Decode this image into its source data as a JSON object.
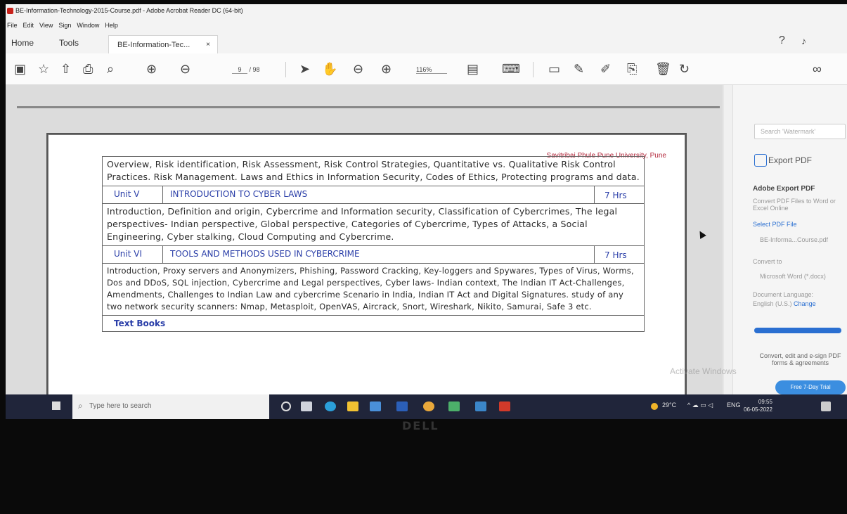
{
  "window": {
    "title": "BE-Information-Technology-2015-Course.pdf - Adobe Acrobat Reader DC (64-bit)",
    "menu": [
      "File",
      "Edit",
      "View",
      "Sign",
      "Window",
      "Help"
    ]
  },
  "tabs": {
    "home": "Home",
    "tools": "Tools",
    "document": "BE-Information-Tec...",
    "close": "×"
  },
  "toolbar": {
    "page_current": "9",
    "page_total": "/ 98",
    "zoom": "116%"
  },
  "page": {
    "university": "Savitribai Phule Pune University, Pune",
    "intro_text": "Overview, Risk identification, Risk Assessment, Risk Control Strategies, Quantitative vs. Qualitative Risk Control Practices. Risk Management. Laws and Ethics in Information Security, Codes of Ethics, Protecting programs and data.",
    "units": [
      {
        "unit": "Unit V",
        "title": "INTRODUCTION TO CYBER LAWS",
        "hours": "7 Hrs",
        "content": "Introduction, Definition and origin, Cybercrime and Information security, Classification of Cybercrimes, The legal perspectives- Indian perspective, Global perspective, Categories of Cybercrime, Types of Attacks, a Social Engineering, Cyber stalking, Cloud Computing and Cybercrime."
      },
      {
        "unit": "Unit VI",
        "title": "TOOLS AND METHODS USED IN CYBERCRIME",
        "hours": "7 Hrs",
        "content": "Introduction, Proxy servers and Anonymizers, Phishing, Password Cracking, Key-loggers and Spywares, Types of Virus, Worms, Dos and DDoS, SQL injection, Cybercrime and Legal perspectives, Cyber laws- Indian context, The Indian IT Act-Challenges, Amendments, Challenges to Indian Law and cybercrime Scenario in India, Indian IT Act and Digital Signatures. study of any two network security scanners: Nmap, Metasploit, OpenVAS, Aircrack, Snort, Wireshark, Nikito, Samurai, Safe 3 etc."
      }
    ],
    "next_heading": "Text Books"
  },
  "right_panel": {
    "search_placeholder": "Search 'Watermark'",
    "export_title": "Export PDF",
    "heading": "Adobe Export PDF",
    "desc": "Convert PDF Files to Word or Excel Online",
    "select_label": "Select PDF File",
    "file_name": "BE-Informa...Course.pdf",
    "convert_to": "Convert to",
    "format": "Microsoft Word (*.docx)",
    "doc_language_label": "Document Language:",
    "doc_language": "English (U.S.)",
    "change": "Change",
    "promo": "Convert, edit and e-sign PDF forms & agreements",
    "trial": "Free 7-Day Trial"
  },
  "watermark": "Activate Windows",
  "taskbar": {
    "search_placeholder": "Type here to search",
    "weather": "29°C",
    "lang": "ENG",
    "time": "09:55",
    "date": "06-05-2022"
  },
  "monitor_brand": "DELL"
}
